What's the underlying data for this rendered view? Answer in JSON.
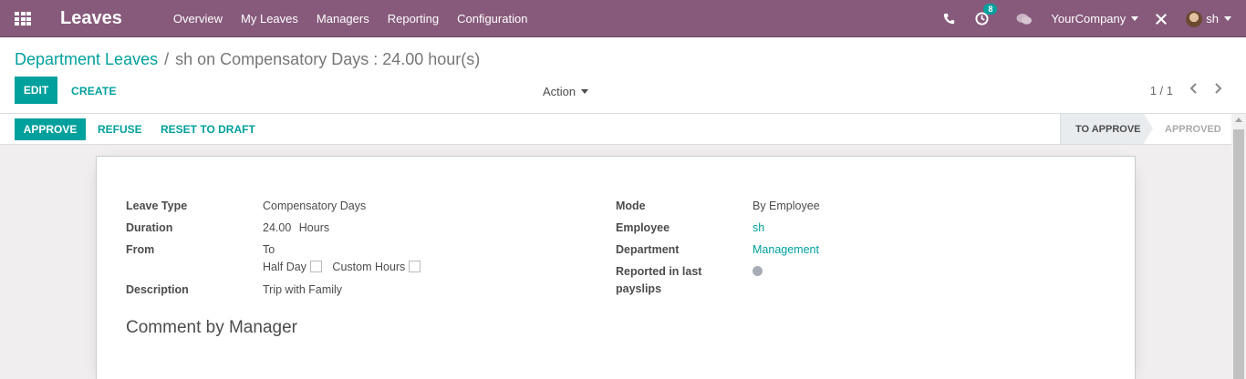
{
  "navbar": {
    "app_name": "Leaves",
    "menu": [
      "Overview",
      "My Leaves",
      "Managers",
      "Reporting",
      "Configuration"
    ],
    "activity_count": "8",
    "company": "YourCompany",
    "user": "sh"
  },
  "control_panel": {
    "breadcrumb_parent": "Department Leaves",
    "breadcrumb_separator": "/",
    "breadcrumb_current": "sh on Compensatory Days : 24.00 hour(s)",
    "edit_label": "EDIT",
    "create_label": "CREATE",
    "action_label": "Action",
    "pager": "1 / 1"
  },
  "statusbar": {
    "approve_label": "APPROVE",
    "refuse_label": "REFUSE",
    "reset_label": "RESET TO DRAFT",
    "stage_current": "TO APPROVE",
    "stage_next": "APPROVED"
  },
  "form": {
    "leave_type_label": "Leave Type",
    "leave_type_value": "Compensatory Days",
    "duration_label": "Duration",
    "duration_value": "24.00",
    "duration_unit": "Hours",
    "from_label": "From",
    "to_label": "To",
    "half_day_label": "Half Day",
    "custom_hours_label": "Custom Hours",
    "description_label": "Description",
    "description_value": "Trip with Family",
    "mode_label": "Mode",
    "mode_value": "By Employee",
    "employee_label": "Employee",
    "employee_value": "sh",
    "department_label": "Department",
    "department_value": "Management",
    "reported_label_line1": "Reported in last",
    "reported_label_line2": "payslips",
    "comment_title": "Comment by Manager"
  },
  "colors": {
    "navbar": "#875a7b",
    "primary": "#00a09d"
  }
}
